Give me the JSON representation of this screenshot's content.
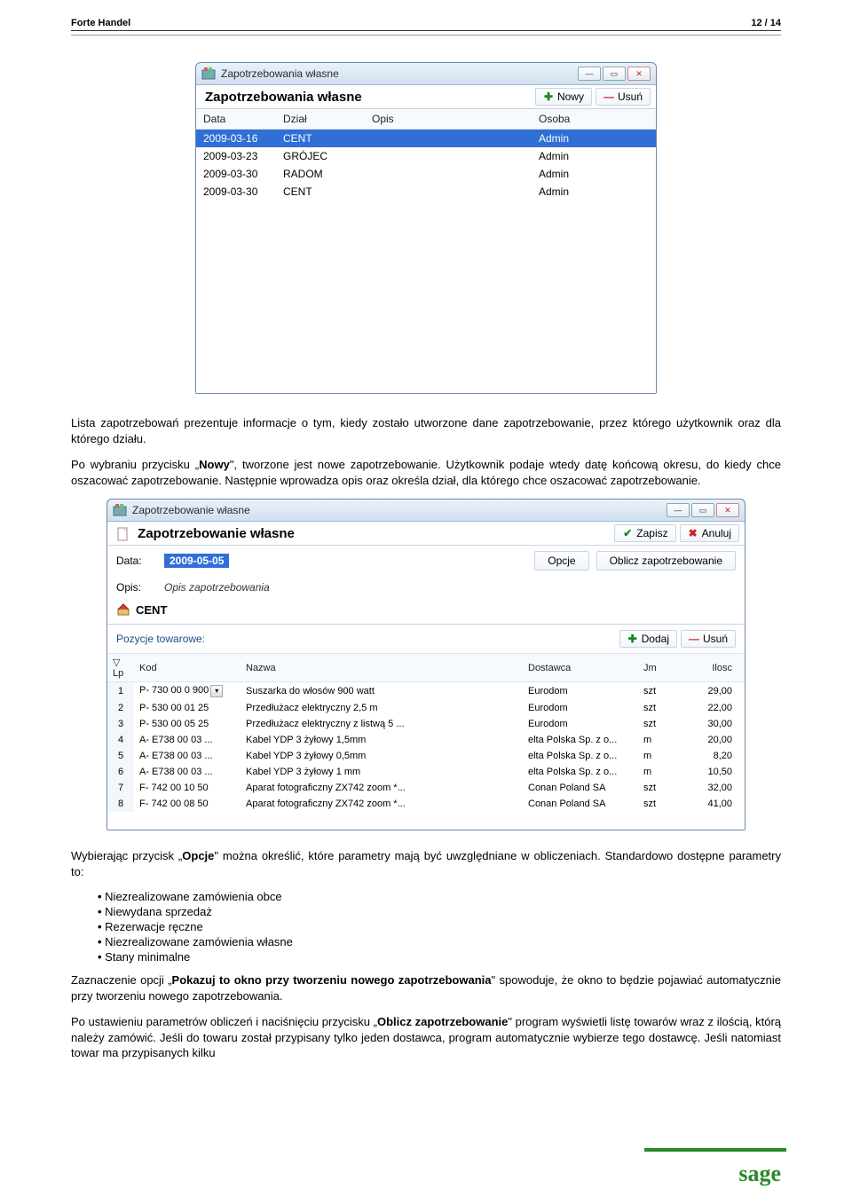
{
  "doc": {
    "header_left": "Forte Handel",
    "header_right": "12 / 14",
    "logo": "sage"
  },
  "win1": {
    "title": "Zapotrzebowania własne",
    "toolbar_title": "Zapotrzebowania własne",
    "btn_new": "Nowy",
    "btn_del": "Usuń",
    "cols": {
      "c1": "Data",
      "c2": "Dział",
      "c3": "Opis",
      "c4": "Osoba"
    },
    "rows": [
      {
        "c1": "2009-03-16",
        "c2": "CENT",
        "c3": "",
        "c4": "Admin"
      },
      {
        "c1": "2009-03-23",
        "c2": "GRÓJEC",
        "c3": "",
        "c4": "Admin"
      },
      {
        "c1": "2009-03-30",
        "c2": "RADOM",
        "c3": "",
        "c4": "Admin"
      },
      {
        "c1": "2009-03-30",
        "c2": "CENT",
        "c3": "",
        "c4": "Admin"
      }
    ]
  },
  "para1": "Lista zapotrzebowań prezentuje informacje o tym, kiedy zostało utworzone dane zapotrzebowanie, przez którego użytkownik oraz dla którego działu.",
  "para2_a": "Po wybraniu przycisku „",
  "para2_b": "Nowy",
  "para2_c": "\", tworzone jest nowe zapotrzebowanie. Użytkownik podaje wtedy datę końcową okresu, do kiedy chce oszacować zapotrzebowanie. Następnie wprowadza opis oraz określa dział, dla którego chce oszacować zapotrzebowanie.",
  "win2": {
    "title": "Zapotrzebowanie własne",
    "toolbar_title": "Zapotrzebowanie własne",
    "btn_save": "Zapisz",
    "btn_cancel": "Anuluj",
    "lbl_data": "Data:",
    "val_data": "2009-05-05",
    "btn_opts": "Opcje",
    "btn_calc": "Oblicz zapotrzebowanie",
    "lbl_opis": "Opis:",
    "val_opis": "Opis zapotrzebowania",
    "dept": "CENT",
    "sect_title": "Pozycje towarowe:",
    "btn_add": "Dodaj",
    "btn_del": "Usuń",
    "cols": {
      "lp": "Lp",
      "kod": "Kod",
      "nazwa": "Nazwa",
      "dost": "Dostawca",
      "jm": "Jm",
      "il": "Ilosc"
    },
    "rows": [
      {
        "lp": "1",
        "kod": "P- 730 00 0 900",
        "nazwa": "Suszarka do włosów 900 watt",
        "dost": "Eurodom",
        "jm": "szt",
        "il": "29,00",
        "drop": true
      },
      {
        "lp": "2",
        "kod": "P- 530 00 01 25",
        "nazwa": "Przedłużacz elektryczny 2,5 m",
        "dost": "Eurodom",
        "jm": "szt",
        "il": "22,00"
      },
      {
        "lp": "3",
        "kod": "P- 530 00 05 25",
        "nazwa": "Przedłużacz elektryczny z listwą 5 ...",
        "dost": "Eurodom",
        "jm": "szt",
        "il": "30,00"
      },
      {
        "lp": "4",
        "kod": "A- E738 00 03 ...",
        "nazwa": "Kabel YDP 3 żyłowy 1,5mm",
        "dost": "elta Polska Sp. z o...",
        "jm": "m",
        "il": "20,00"
      },
      {
        "lp": "5",
        "kod": "A- E738 00 03 ...",
        "nazwa": "Kabel YDP 3 żyłowy 0,5mm",
        "dost": "elta Polska Sp. z o...",
        "jm": "m",
        "il": "8,20"
      },
      {
        "lp": "6",
        "kod": "A- E738 00 03 ...",
        "nazwa": "Kabel YDP 3 żyłowy 1 mm",
        "dost": "elta Polska Sp. z o...",
        "jm": "m",
        "il": "10,50"
      },
      {
        "lp": "7",
        "kod": "F- 742 00 10 50",
        "nazwa": "Aparat fotograficzny ZX742 zoom *...",
        "dost": "Conan Poland SA",
        "jm": "szt",
        "il": "32,00"
      },
      {
        "lp": "8",
        "kod": "F- 742 00 08 50",
        "nazwa": "Aparat fotograficzny ZX742 zoom *...",
        "dost": "Conan Poland SA",
        "jm": "szt",
        "il": "41,00"
      }
    ]
  },
  "para3_a": "Wybierając przycisk „",
  "para3_b": "Opcje",
  "para3_c": "\" można określić, które parametry mają być uwzględniane w obliczeniach. Standardowo dostępne parametry to:",
  "bullets": [
    "Niezrealizowane zamówienia obce",
    "Niewydana sprzedaż",
    "Rezerwacje ręczne",
    "Niezrealizowane zamówienia własne",
    "Stany minimalne"
  ],
  "para4_a": "Zaznaczenie opcji „",
  "para4_b": "Pokazuj to okno przy tworzeniu nowego zapotrzebowania",
  "para4_c": "\" spowoduje, że okno to będzie pojawiać automatycznie przy tworzeniu nowego zapotrzebowania.",
  "para5_a": "Po ustawieniu parametrów obliczeń i naciśnięciu przycisku „",
  "para5_b": "Oblicz zapotrzebowanie",
  "para5_c": "\" program wyświetli listę towarów wraz z ilością, którą należy zamówić. Jeśli do towaru został przypisany tylko jeden dostawca, program automatycznie wybierze tego dostawcę. Jeśli natomiast towar ma przypisanych kilku"
}
